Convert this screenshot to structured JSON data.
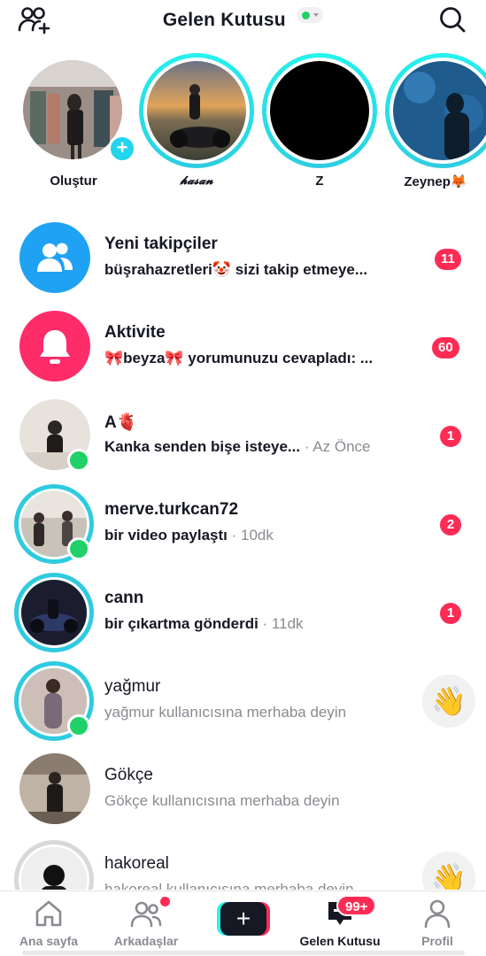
{
  "header": {
    "title": "Gelen Kutusu",
    "status_color": "#20d167",
    "left_icon": "add-friends-icon",
    "right_icon": "search-icon"
  },
  "stories": [
    {
      "name": "Oluştur",
      "type": "create"
    },
    {
      "name": "𝓱𝓪𝓼𝓪𝓷",
      "type": "story"
    },
    {
      "name": "Z",
      "type": "story"
    },
    {
      "name": "Zeynep🦊",
      "type": "story"
    }
  ],
  "list": [
    {
      "title": "Yeni takipçiler",
      "subtitle": "büşrahazretleri🤡 sizi takip etmeye...",
      "time": "",
      "badge": "11",
      "kind": "system-followers"
    },
    {
      "title": "Aktivite",
      "subtitle": "🎀beyza🎀 yorumunuzu cevapladı: ...",
      "time": "",
      "badge": "60",
      "kind": "system-activity"
    },
    {
      "title": "A🫀",
      "subtitle": "Kanka senden bişe isteye...",
      "time": " · Az Önce",
      "badge": "1",
      "kind": "chat"
    },
    {
      "title": "merve.turkcan72",
      "subtitle": "bir video paylaştı",
      "time": " · 10dk",
      "badge": "2",
      "kind": "chat"
    },
    {
      "title": "cann",
      "subtitle": "bir çıkartma gönderdi",
      "time": " · 11dk",
      "badge": "1",
      "kind": "chat"
    },
    {
      "title": "yağmur",
      "subtitle": "yağmur kullanıcısına merhaba deyin",
      "time": "",
      "badge": "",
      "kind": "suggest"
    },
    {
      "title": "Gökçe",
      "subtitle": "Gökçe kullanıcısına merhaba deyin",
      "time": "",
      "badge": "",
      "kind": "suggest"
    },
    {
      "title": "hakoreal",
      "subtitle": "hakoreal kullanıcısına merhaba deyin",
      "time": "",
      "badge": "",
      "kind": "suggest"
    }
  ],
  "wave_emoji": "👋",
  "tabbar": {
    "home": "Ana sayfa",
    "friends": "Arkadaşlar",
    "create": "+",
    "inbox": "Gelen Kutusu",
    "inbox_badge": "99+",
    "profile": "Profil"
  },
  "colors": {
    "accent_red": "#fe2c55",
    "accent_cyan": "#25f4ee",
    "online_green": "#20d167",
    "followers_blue": "#1fa2f3",
    "activity_pink": "#fe2c69"
  }
}
